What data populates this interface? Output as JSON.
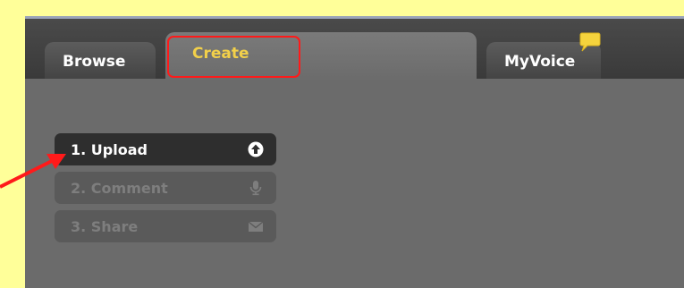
{
  "tabs": {
    "browse": "Browse",
    "create": "Create",
    "myvoice": "MyVoice"
  },
  "steps": [
    {
      "label": "1. Upload",
      "icon": "upload-icon",
      "state": "active"
    },
    {
      "label": "2. Comment",
      "icon": "microphone-icon",
      "state": "disabled"
    },
    {
      "label": "3. Share",
      "icon": "envelope-icon",
      "state": "disabled"
    }
  ],
  "colors": {
    "page_background": "#ffff99",
    "panel": "#6b6b6b",
    "active_tab_text": "#f2d04a",
    "highlight": "#ff1a1a",
    "notification_bubble": "#f5d33d"
  }
}
